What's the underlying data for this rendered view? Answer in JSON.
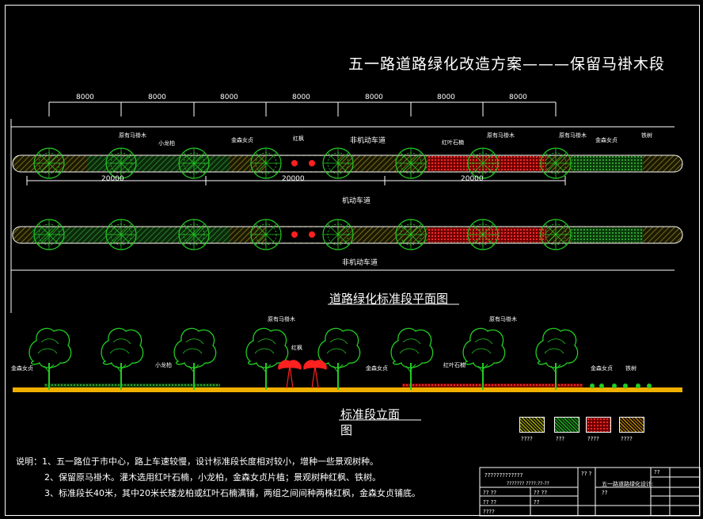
{
  "title": "五一路道路绿化改造方案———保留马褂木段",
  "dimensions": {
    "top_spans": [
      "8000",
      "8000",
      "8000",
      "8000",
      "8000",
      "8000",
      "8000"
    ],
    "mid_spans": [
      "20000",
      "20000",
      "20000"
    ]
  },
  "plan": {
    "label_tree_1a": "原有马褂木",
    "label_shrub_1": "小龙柏",
    "label_gold_1": "金森女贞",
    "label_maple_1": "红枫",
    "label_lane_top": "非机动车道",
    "label_photinia": "红叶石楠",
    "label_tree_1b": "原有马褂木",
    "label_tree_1c": "原有马褂木",
    "label_gold_2": "金森女贞",
    "label_iron": "铁树",
    "label_motor": "机动车道",
    "label_lane_bottom": "非机动车道",
    "caption": "道路绿化标准段平面图"
  },
  "elevation": {
    "label_gold_left": "金森女贞",
    "label_shrub": "小龙柏",
    "label_tree_a": "原有马褂木",
    "label_maple": "红枫",
    "label_gold_mid": "金森女贞",
    "label_photinia": "红叶石楠",
    "label_tree_b": "原有马褂木",
    "label_gold_right": "金森女贞",
    "label_iron": "铁树",
    "caption_line1": "标准段立面",
    "caption_line2": "图"
  },
  "legend": {
    "labels": [
      "????",
      "???",
      "????",
      "????"
    ],
    "colors": [
      "#c8c800",
      "#22cc22",
      "#ff2020",
      "#e0a000"
    ]
  },
  "notes": [
    "说明：1、五一路位于市中心，路上车速较慢，设计标准段长度相对较小，增种一些景观树种。",
    "2、保留原马褂木。灌木选用红叶石楠，小龙柏，金森女贞片植；景观树种红枫、铁树。",
    "3、标准段长40米，其中20米长矮龙柏或红叶石楠满铺，两组之间间种两株红枫，金森女贞铺底。"
  ],
  "titleblock": {
    "r1": "?????????????",
    "r2": "??????? ????:??-??",
    "c1": "?? ??",
    "c2": "五一路道路绿化设计:",
    "c3": "?? ??",
    "c4": "??",
    "c5": "?? ??",
    "c6": "??",
    "c7": "?? ?",
    "c8": "????",
    "c9": "??"
  },
  "colors": {
    "tree": "#22cc22",
    "maple": "#ff2020",
    "hatch_green": "#2a8a2a",
    "hatch_red": "#cc1010",
    "ground": "#f0b000",
    "white": "#ffffff"
  }
}
